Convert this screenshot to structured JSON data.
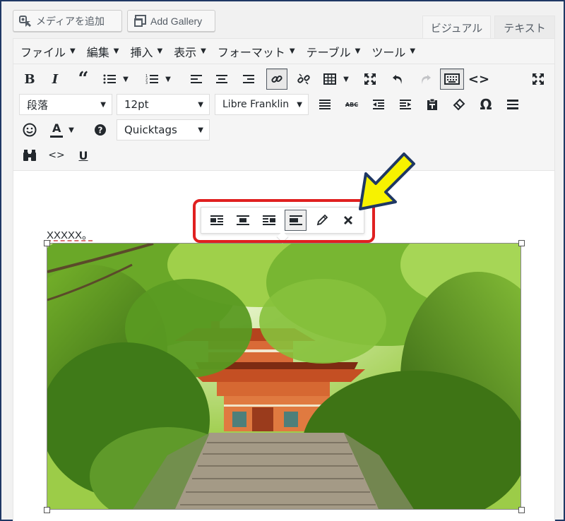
{
  "media_buttons": {
    "add_media": "メディアを追加",
    "add_gallery": "Add Gallery"
  },
  "editor_tabs": {
    "visual": "ビジュアル",
    "text": "テキスト"
  },
  "menubar": [
    {
      "label": "ファイル"
    },
    {
      "label": "編集"
    },
    {
      "label": "挿入"
    },
    {
      "label": "表示"
    },
    {
      "label": "フォーマット"
    },
    {
      "label": "テーブル"
    },
    {
      "label": "ツール"
    }
  ],
  "selects": {
    "format": "段落",
    "font_size": "12pt",
    "font_family": "Libre Franklin",
    "quicktags": "Quicktags"
  },
  "content": {
    "paragraph_text": "XXXXX。"
  },
  "colors": {
    "highlight_box": "#e02020",
    "arrow_fill": "#f7f200",
    "arrow_stroke": "#1f3864",
    "frame": "#1f3864"
  },
  "icons": {
    "row1": [
      "bold-icon",
      "italic-icon",
      "blockquote-icon",
      "bullet-list-icon",
      "numbered-list-icon",
      "align-left-icon",
      "align-center-icon",
      "align-right-icon",
      "link-icon",
      "unlink-icon",
      "table-icon",
      "fullscreen-icon",
      "undo-icon",
      "redo-icon",
      "keyboard-icon",
      "code-icon",
      "distraction-free-icon"
    ],
    "image_toolbar": [
      "align-left-icon",
      "align-center-icon",
      "align-right-icon",
      "align-none-icon",
      "pencil-icon",
      "close-icon"
    ]
  }
}
